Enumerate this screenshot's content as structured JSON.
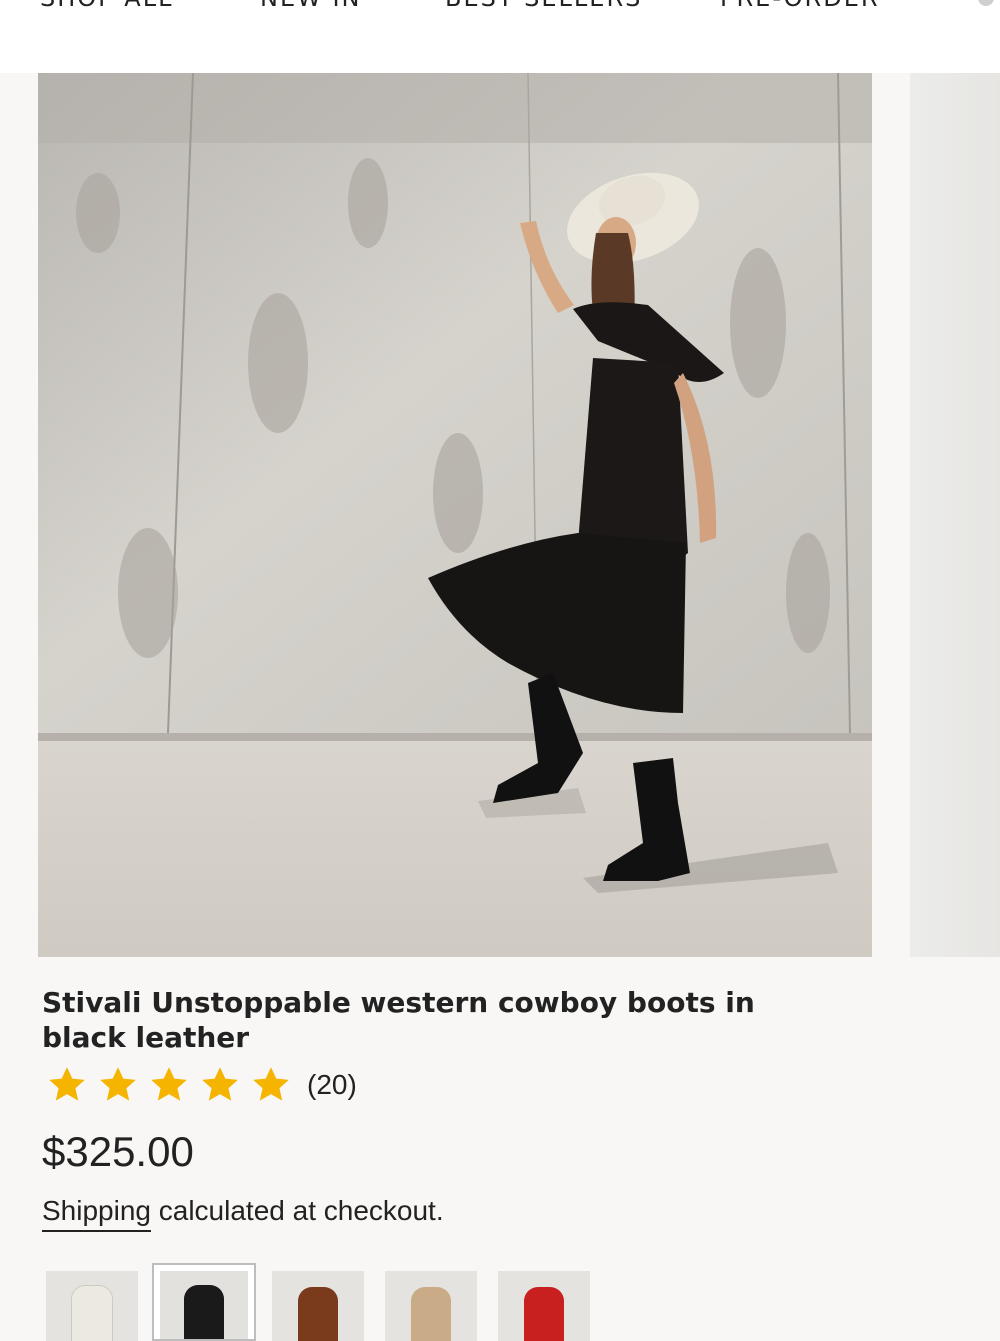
{
  "nav": {
    "items": [
      "SHOP ALL",
      "NEW IN",
      "BEST SELLERS",
      "PRE-ORDER"
    ]
  },
  "product": {
    "title": "Stivali Unstoppable western cowboy boots in black leather",
    "rating": {
      "stars": 5,
      "max": 5,
      "count": "(20)"
    },
    "price": "$325.00",
    "shipping_link": "Shipping",
    "shipping_rest": " calculated at checkout."
  },
  "swatches": [
    {
      "name": "cream",
      "color": "#ece9e0",
      "selected": false
    },
    {
      "name": "black",
      "color": "#1a1a1a",
      "selected": true
    },
    {
      "name": "brown",
      "color": "#7a3b1c",
      "selected": false
    },
    {
      "name": "tan",
      "color": "#c9ab88",
      "selected": false
    },
    {
      "name": "red",
      "color": "#c8201f",
      "selected": false
    }
  ],
  "colors": {
    "star": "#f4b400",
    "text": "#222222"
  },
  "icons": {
    "star": "star-icon",
    "cart": "cart-icon"
  }
}
